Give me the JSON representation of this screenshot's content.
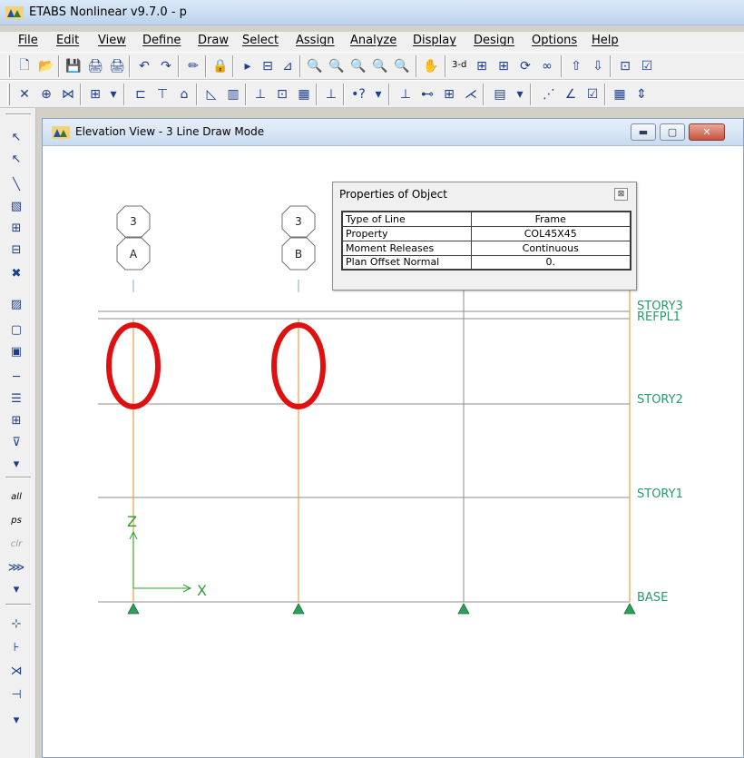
{
  "window": {
    "title": "ETABS Nonlinear v9.7.0 - p"
  },
  "menu": [
    "File",
    "Edit",
    "View",
    "Define",
    "Draw",
    "Select",
    "Assign",
    "Analyze",
    "Display",
    "Design",
    "Options",
    "Help"
  ],
  "toolbar": {
    "view_3d_label": "3-d"
  },
  "left_toolbar": {
    "select_all_label": "all",
    "select_ps_label": "ps",
    "clear_label": "clr"
  },
  "child_window": {
    "title": "Elevation View - 3  Line Draw Mode"
  },
  "grid_bubbles": [
    {
      "number": "3",
      "letter": "A"
    },
    {
      "number": "3",
      "letter": "B"
    }
  ],
  "story_labels": [
    "STORY3",
    "REFPL1",
    "STORY2",
    "STORY1",
    "BASE"
  ],
  "axes": {
    "z_label": "Z",
    "x_label": "X"
  },
  "properties_panel": {
    "title": "Properties of Object",
    "rows": [
      {
        "key": "Type of Line",
        "value": "Frame"
      },
      {
        "key": "Property",
        "value": "COL45X45"
      },
      {
        "key": "Moment Releases",
        "value": "Continuous"
      },
      {
        "key": "Plan Offset Normal",
        "value": "0."
      }
    ]
  },
  "colors": {
    "column": "#e8a042",
    "story_line": "#8c8c8c",
    "story_label": "#2b9a6a",
    "axis": "#2aa52a",
    "highlight_circle": "#e01010",
    "support": "#2e9e5e"
  }
}
